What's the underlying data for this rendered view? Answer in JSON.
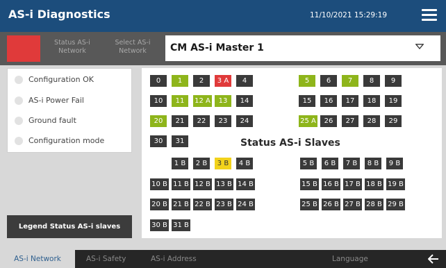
{
  "header": {
    "title": "AS-i Diagnostics",
    "datetime": "11/10/2021 15:29:19",
    "menu_icon": "hamburger-menu-icon"
  },
  "selection": {
    "status_label": "Status AS-i\nNetwork",
    "select_label": "Select AS-i\nNetwork",
    "network_value": "CM AS-i Master 1",
    "status_color": "#e03a3a"
  },
  "status_items": [
    {
      "label": "Configuration OK"
    },
    {
      "label": "AS-i Power Fail"
    },
    {
      "label": "Ground fault"
    },
    {
      "label": "Configuration mode"
    }
  ],
  "legend_button": "Legend Status AS-i slaves",
  "grid_title": "Status AS-i Slaves",
  "colors": {
    "dark": "#3a3a3a",
    "green": "#8eb51b",
    "red": "#e03a3a",
    "yellow": "#f2d21b"
  },
  "slaves": [
    {
      "label": "0",
      "status": "dark"
    },
    {
      "label": "1",
      "status": "green"
    },
    {
      "label": "2",
      "status": "dark"
    },
    {
      "label": "3 A",
      "status": "red"
    },
    {
      "label": "4",
      "status": "dark"
    },
    {
      "label": "5",
      "status": "green"
    },
    {
      "label": "6",
      "status": "dark"
    },
    {
      "label": "7",
      "status": "green"
    },
    {
      "label": "8",
      "status": "dark"
    },
    {
      "label": "9",
      "status": "dark"
    },
    {
      "label": "10",
      "status": "dark"
    },
    {
      "label": "11",
      "status": "green"
    },
    {
      "label": "12 A",
      "status": "green"
    },
    {
      "label": "13",
      "status": "green"
    },
    {
      "label": "14",
      "status": "dark"
    },
    {
      "label": "15",
      "status": "dark"
    },
    {
      "label": "16",
      "status": "dark"
    },
    {
      "label": "17",
      "status": "dark"
    },
    {
      "label": "18",
      "status": "dark"
    },
    {
      "label": "19",
      "status": "dark"
    },
    {
      "label": "20",
      "status": "green"
    },
    {
      "label": "21",
      "status": "dark"
    },
    {
      "label": "22",
      "status": "dark"
    },
    {
      "label": "23",
      "status": "dark"
    },
    {
      "label": "24",
      "status": "dark"
    },
    {
      "label": "25 A",
      "status": "green"
    },
    {
      "label": "26",
      "status": "dark"
    },
    {
      "label": "27",
      "status": "dark"
    },
    {
      "label": "28",
      "status": "dark"
    },
    {
      "label": "29",
      "status": "dark"
    },
    {
      "label": "30",
      "status": "dark"
    },
    {
      "label": "31",
      "status": "dark"
    },
    {
      "label": "1 B",
      "status": "dark"
    },
    {
      "label": "2 B",
      "status": "dark"
    },
    {
      "label": "3 B",
      "status": "yellow"
    },
    {
      "label": "4 B",
      "status": "dark"
    },
    {
      "label": "5 B",
      "status": "dark"
    },
    {
      "label": "6 B",
      "status": "dark"
    },
    {
      "label": "7 B",
      "status": "dark"
    },
    {
      "label": "8 B",
      "status": "dark"
    },
    {
      "label": "9 B",
      "status": "dark"
    },
    {
      "label": "10 B",
      "status": "dark"
    },
    {
      "label": "11 B",
      "status": "dark"
    },
    {
      "label": "12 B",
      "status": "dark"
    },
    {
      "label": "13 B",
      "status": "dark"
    },
    {
      "label": "14 B",
      "status": "dark"
    },
    {
      "label": "15 B",
      "status": "dark"
    },
    {
      "label": "16 B",
      "status": "dark"
    },
    {
      "label": "17 B",
      "status": "dark"
    },
    {
      "label": "18 B",
      "status": "dark"
    },
    {
      "label": "19 B",
      "status": "dark"
    },
    {
      "label": "20 B",
      "status": "dark"
    },
    {
      "label": "21 B",
      "status": "dark"
    },
    {
      "label": "22 B",
      "status": "dark"
    },
    {
      "label": "23 B",
      "status": "dark"
    },
    {
      "label": "24 B",
      "status": "dark"
    },
    {
      "label": "25 B",
      "status": "dark"
    },
    {
      "label": "26 B",
      "status": "dark"
    },
    {
      "label": "27 B",
      "status": "dark"
    },
    {
      "label": "28 B",
      "status": "dark"
    },
    {
      "label": "29 B",
      "status": "dark"
    },
    {
      "label": "30 B",
      "status": "dark"
    },
    {
      "label": "31 B",
      "status": "dark"
    }
  ],
  "tabs": [
    {
      "label": "AS-i Network",
      "active": true
    },
    {
      "label": "AS-i Safety",
      "active": false
    },
    {
      "label": "AS-i Address",
      "active": false
    },
    {
      "label": "Language",
      "active": false
    }
  ],
  "back_icon": "back-arrow-icon"
}
